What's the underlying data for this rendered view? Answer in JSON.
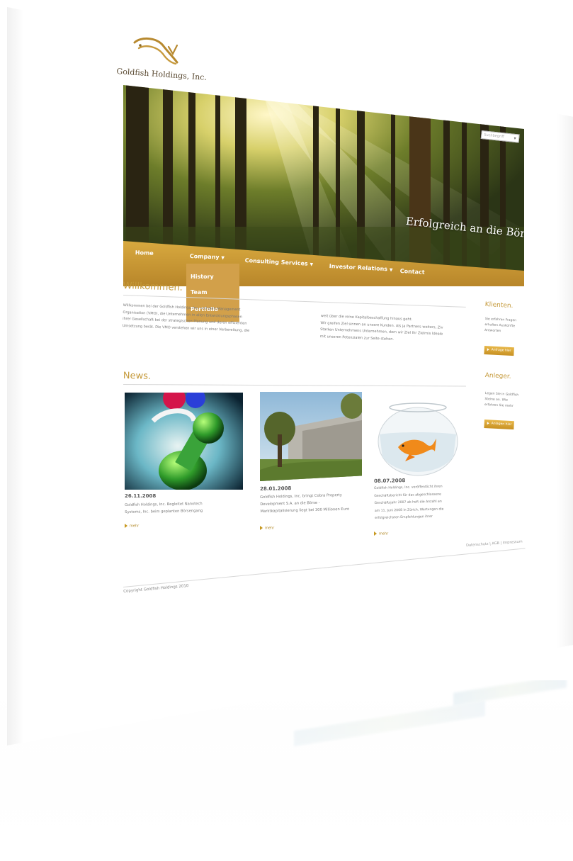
{
  "brand": {
    "company_name": "Goldfish Holdings, Inc.",
    "accent_color": "#c59a3b",
    "logo_icon": "goldfish-logo"
  },
  "search": {
    "placeholder": "Suchbegriff"
  },
  "hero": {
    "tagline": "Erfolgreich an die Börse"
  },
  "nav": {
    "items": [
      {
        "label": "Home"
      },
      {
        "label": "Company"
      },
      {
        "label": "Consulting Services"
      },
      {
        "label": "Investor Relations"
      },
      {
        "label": "Contact"
      }
    ],
    "dropdown": [
      {
        "label": "History"
      },
      {
        "label": "Team"
      },
      {
        "label": "Portfolio"
      }
    ]
  },
  "welcome": {
    "heading": "Willkommen.",
    "col1": [
      "Willkommen bei der Goldfish Holdings, Inc. und dem Management",
      "Organisation (VMO), die Unternehmen in allen Entwicklungsphasen",
      "ihrer Gesellschaft bei der strategischen Planung und deren effizienten",
      "Umsetzung berät. Die VMO verstehen wir uns in einer Vorbereitung, die"
    ],
    "col2": [
      "weit über die reine Kapitalbeschaffung hinaus geht.",
      "Wir greifen Ziel sinnen an unsere Kunden. Als ja Partners weiters, Ziv",
      "Starken Unternehmens Unternehmen, dem wir Ziel Ihr Zielrnis Ideale",
      "mit unseren Potenzialen zur Seite stehen."
    ]
  },
  "sidebar": {
    "clients_heading": "Klienten.",
    "clients_text": [
      "Sie erfahren Fragen",
      "erhalten Auskünfte",
      "Antworten"
    ],
    "clients_button": "Anfrage hier",
    "investors_heading": "Anleger.",
    "investors_text": [
      "Legen Sie in Goldfish",
      "Steine an. Wie",
      "erfahren Sie mehr"
    ],
    "investors_button": "Anlagen hier"
  },
  "news": {
    "heading": "News.",
    "more_label": "mehr",
    "items": [
      {
        "date": "26.11.2008",
        "lines": [
          "Goldfish Holdings, Inc. Begleitet Nanotech",
          "Systems, Inc. beim geplanten Börsengang"
        ]
      },
      {
        "date": "28.01.2008",
        "lines": [
          "Goldfish Holdings, Inc. bringt Cobra Property",
          "Development S.A. an die Börse -",
          "Marktkapitalisierung liegt bei 300 Millionen Euro"
        ]
      },
      {
        "date": "08.07.2008",
        "lines": [
          "Goldfish Holdings, Inc. veröffentlicht ihren",
          "Geschäftsbericht für das abgeschlossene",
          "Geschäftsjahr 2007 ab heft die Anzahl an",
          "am 11. Juni 2008 in Zürich, Wertungen die",
          "erfolgreichsten Empfehlungen ihrer"
        ]
      }
    ]
  },
  "footer": {
    "links": [
      "Datenschutz",
      "AGB",
      "Impressum"
    ],
    "separator": "|",
    "copyright": "Copyright Goldfish Holdings 2010"
  }
}
